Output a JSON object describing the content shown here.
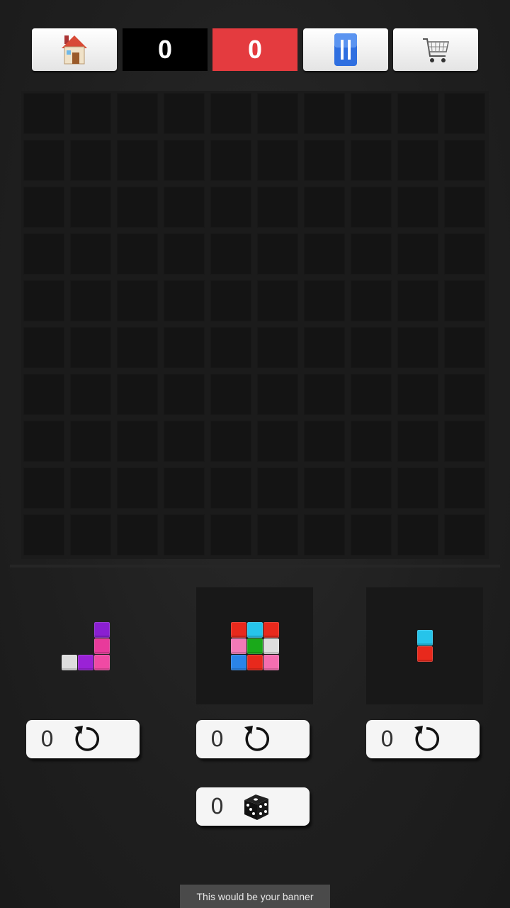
{
  "toolbar": {
    "home_icon": "house-icon",
    "score_current": "0",
    "score_best": "0",
    "pause_icon": "pause-icon",
    "shop_icon": "cart-icon"
  },
  "board": {
    "rows": 10,
    "cols": 10
  },
  "pieces": [
    {
      "name": "L-piece",
      "blocks": [
        {
          "c": 2,
          "r": 0,
          "color": "#8a1fd1"
        },
        {
          "c": 2,
          "r": 1,
          "color": "#e83a9b"
        },
        {
          "c": 0,
          "r": 2,
          "color": "#dedede"
        },
        {
          "c": 1,
          "r": 2,
          "color": "#9a22d6"
        },
        {
          "c": 2,
          "r": 2,
          "color": "#f04aa4"
        }
      ]
    },
    {
      "name": "square-3x3",
      "blocks": [
        {
          "c": 0,
          "r": 0,
          "color": "#e8291c"
        },
        {
          "c": 1,
          "r": 0,
          "color": "#26c4ea"
        },
        {
          "c": 2,
          "r": 0,
          "color": "#e8291c"
        },
        {
          "c": 0,
          "r": 1,
          "color": "#f27ab7"
        },
        {
          "c": 1,
          "r": 1,
          "color": "#1aa91a"
        },
        {
          "c": 2,
          "r": 1,
          "color": "#dedede"
        },
        {
          "c": 0,
          "r": 2,
          "color": "#2a84e8"
        },
        {
          "c": 1,
          "r": 2,
          "color": "#e8291c"
        },
        {
          "c": 2,
          "r": 2,
          "color": "#f46eb0"
        }
      ]
    },
    {
      "name": "vertical-2",
      "blocks": [
        {
          "c": 0,
          "r": 0,
          "color": "#26c4ea"
        },
        {
          "c": 0,
          "r": 1,
          "color": "#e8291c"
        }
      ]
    }
  ],
  "rotate_buttons": [
    {
      "count": "0",
      "icon": "rotate-icon"
    },
    {
      "count": "0",
      "icon": "rotate-icon"
    },
    {
      "count": "0",
      "icon": "rotate-icon"
    }
  ],
  "dice_button": {
    "count": "0",
    "icon": "dice-icon"
  },
  "banner": {
    "text": "This would be your banner"
  }
}
